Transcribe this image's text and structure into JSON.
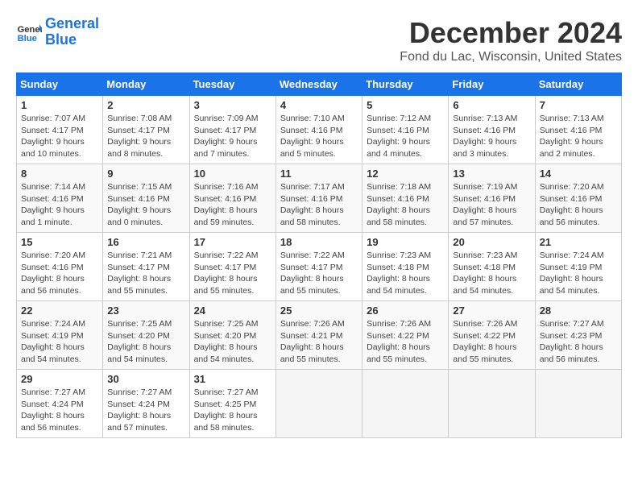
{
  "header": {
    "logo_line1": "General",
    "logo_line2": "Blue",
    "month": "December 2024",
    "location": "Fond du Lac, Wisconsin, United States"
  },
  "weekdays": [
    "Sunday",
    "Monday",
    "Tuesday",
    "Wednesday",
    "Thursday",
    "Friday",
    "Saturday"
  ],
  "weeks": [
    [
      {
        "day": "1",
        "sunrise": "Sunrise: 7:07 AM",
        "sunset": "Sunset: 4:17 PM",
        "daylight": "Daylight: 9 hours and 10 minutes."
      },
      {
        "day": "2",
        "sunrise": "Sunrise: 7:08 AM",
        "sunset": "Sunset: 4:17 PM",
        "daylight": "Daylight: 9 hours and 8 minutes."
      },
      {
        "day": "3",
        "sunrise": "Sunrise: 7:09 AM",
        "sunset": "Sunset: 4:17 PM",
        "daylight": "Daylight: 9 hours and 7 minutes."
      },
      {
        "day": "4",
        "sunrise": "Sunrise: 7:10 AM",
        "sunset": "Sunset: 4:16 PM",
        "daylight": "Daylight: 9 hours and 5 minutes."
      },
      {
        "day": "5",
        "sunrise": "Sunrise: 7:12 AM",
        "sunset": "Sunset: 4:16 PM",
        "daylight": "Daylight: 9 hours and 4 minutes."
      },
      {
        "day": "6",
        "sunrise": "Sunrise: 7:13 AM",
        "sunset": "Sunset: 4:16 PM",
        "daylight": "Daylight: 9 hours and 3 minutes."
      },
      {
        "day": "7",
        "sunrise": "Sunrise: 7:13 AM",
        "sunset": "Sunset: 4:16 PM",
        "daylight": "Daylight: 9 hours and 2 minutes."
      }
    ],
    [
      {
        "day": "8",
        "sunrise": "Sunrise: 7:14 AM",
        "sunset": "Sunset: 4:16 PM",
        "daylight": "Daylight: 9 hours and 1 minute."
      },
      {
        "day": "9",
        "sunrise": "Sunrise: 7:15 AM",
        "sunset": "Sunset: 4:16 PM",
        "daylight": "Daylight: 9 hours and 0 minutes."
      },
      {
        "day": "10",
        "sunrise": "Sunrise: 7:16 AM",
        "sunset": "Sunset: 4:16 PM",
        "daylight": "Daylight: 8 hours and 59 minutes."
      },
      {
        "day": "11",
        "sunrise": "Sunrise: 7:17 AM",
        "sunset": "Sunset: 4:16 PM",
        "daylight": "Daylight: 8 hours and 58 minutes."
      },
      {
        "day": "12",
        "sunrise": "Sunrise: 7:18 AM",
        "sunset": "Sunset: 4:16 PM",
        "daylight": "Daylight: 8 hours and 58 minutes."
      },
      {
        "day": "13",
        "sunrise": "Sunrise: 7:19 AM",
        "sunset": "Sunset: 4:16 PM",
        "daylight": "Daylight: 8 hours and 57 minutes."
      },
      {
        "day": "14",
        "sunrise": "Sunrise: 7:20 AM",
        "sunset": "Sunset: 4:16 PM",
        "daylight": "Daylight: 8 hours and 56 minutes."
      }
    ],
    [
      {
        "day": "15",
        "sunrise": "Sunrise: 7:20 AM",
        "sunset": "Sunset: 4:16 PM",
        "daylight": "Daylight: 8 hours and 56 minutes."
      },
      {
        "day": "16",
        "sunrise": "Sunrise: 7:21 AM",
        "sunset": "Sunset: 4:17 PM",
        "daylight": "Daylight: 8 hours and 55 minutes."
      },
      {
        "day": "17",
        "sunrise": "Sunrise: 7:22 AM",
        "sunset": "Sunset: 4:17 PM",
        "daylight": "Daylight: 8 hours and 55 minutes."
      },
      {
        "day": "18",
        "sunrise": "Sunrise: 7:22 AM",
        "sunset": "Sunset: 4:17 PM",
        "daylight": "Daylight: 8 hours and 55 minutes."
      },
      {
        "day": "19",
        "sunrise": "Sunrise: 7:23 AM",
        "sunset": "Sunset: 4:18 PM",
        "daylight": "Daylight: 8 hours and 54 minutes."
      },
      {
        "day": "20",
        "sunrise": "Sunrise: 7:23 AM",
        "sunset": "Sunset: 4:18 PM",
        "daylight": "Daylight: 8 hours and 54 minutes."
      },
      {
        "day": "21",
        "sunrise": "Sunrise: 7:24 AM",
        "sunset": "Sunset: 4:19 PM",
        "daylight": "Daylight: 8 hours and 54 minutes."
      }
    ],
    [
      {
        "day": "22",
        "sunrise": "Sunrise: 7:24 AM",
        "sunset": "Sunset: 4:19 PM",
        "daylight": "Daylight: 8 hours and 54 minutes."
      },
      {
        "day": "23",
        "sunrise": "Sunrise: 7:25 AM",
        "sunset": "Sunset: 4:20 PM",
        "daylight": "Daylight: 8 hours and 54 minutes."
      },
      {
        "day": "24",
        "sunrise": "Sunrise: 7:25 AM",
        "sunset": "Sunset: 4:20 PM",
        "daylight": "Daylight: 8 hours and 54 minutes."
      },
      {
        "day": "25",
        "sunrise": "Sunrise: 7:26 AM",
        "sunset": "Sunset: 4:21 PM",
        "daylight": "Daylight: 8 hours and 55 minutes."
      },
      {
        "day": "26",
        "sunrise": "Sunrise: 7:26 AM",
        "sunset": "Sunset: 4:22 PM",
        "daylight": "Daylight: 8 hours and 55 minutes."
      },
      {
        "day": "27",
        "sunrise": "Sunrise: 7:26 AM",
        "sunset": "Sunset: 4:22 PM",
        "daylight": "Daylight: 8 hours and 55 minutes."
      },
      {
        "day": "28",
        "sunrise": "Sunrise: 7:27 AM",
        "sunset": "Sunset: 4:23 PM",
        "daylight": "Daylight: 8 hours and 56 minutes."
      }
    ],
    [
      {
        "day": "29",
        "sunrise": "Sunrise: 7:27 AM",
        "sunset": "Sunset: 4:24 PM",
        "daylight": "Daylight: 8 hours and 56 minutes."
      },
      {
        "day": "30",
        "sunrise": "Sunrise: 7:27 AM",
        "sunset": "Sunset: 4:24 PM",
        "daylight": "Daylight: 8 hours and 57 minutes."
      },
      {
        "day": "31",
        "sunrise": "Sunrise: 7:27 AM",
        "sunset": "Sunset: 4:25 PM",
        "daylight": "Daylight: 8 hours and 58 minutes."
      },
      null,
      null,
      null,
      null
    ]
  ]
}
